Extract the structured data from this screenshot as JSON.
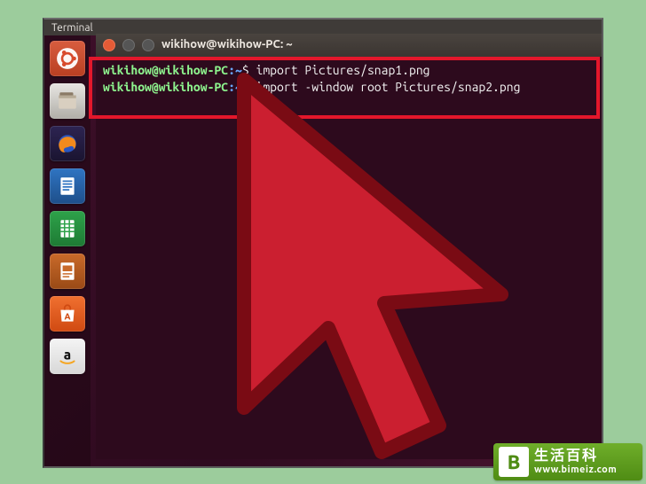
{
  "panel": {
    "title": "Terminal"
  },
  "terminal": {
    "window_title": "wikihow@wikihow-PC: ~",
    "lines": [
      {
        "user": "wikihow@wikihow-PC",
        "sep": ":",
        "path": "~",
        "dollar": "$ ",
        "cmd": "import Pictures/snap1.png"
      },
      {
        "user": "wikihow@wikihow-PC",
        "sep": ":",
        "path": "~",
        "dollar": "$ ",
        "cmd": "import -window root Pictures/snap2.png"
      }
    ]
  },
  "launcher": {
    "items": [
      {
        "name": "dash",
        "label": "Dash"
      },
      {
        "name": "files",
        "label": "Files"
      },
      {
        "name": "firefox",
        "label": "Firefox"
      },
      {
        "name": "writer",
        "label": "LibreOffice Writer"
      },
      {
        "name": "calc",
        "label": "LibreOffice Calc"
      },
      {
        "name": "impress",
        "label": "LibreOffice Impress"
      },
      {
        "name": "software",
        "label": "Ubuntu Software"
      },
      {
        "name": "amazon",
        "label": "Amazon"
      }
    ]
  },
  "colors": {
    "highlight": "#e3172b",
    "cursor_fill": "#cb1f30",
    "cursor_stroke": "#7a0b14",
    "term_bg": "#2d0a1d",
    "prompt_user": "#8df28d",
    "prompt_path": "#6aa8ff"
  },
  "watermark": {
    "logo_letter": "B",
    "cn": "生活百科",
    "url": "www.bimeiz.com"
  }
}
